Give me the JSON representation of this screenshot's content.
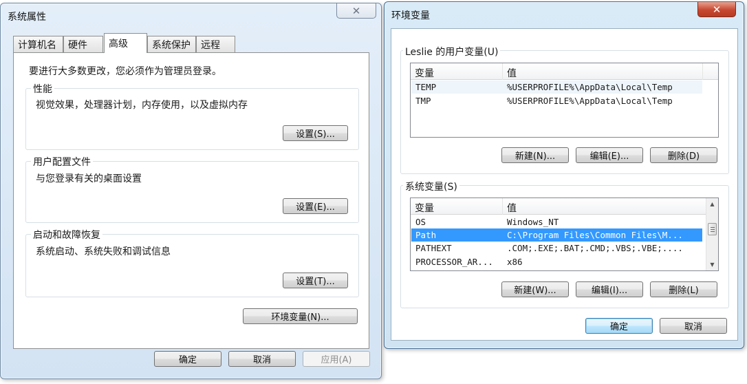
{
  "sys_window": {
    "title": "系统属性",
    "close_label": "✕",
    "tabs": [
      {
        "label": "计算机名"
      },
      {
        "label": "硬件"
      },
      {
        "label": "高级"
      },
      {
        "label": "系统保护"
      },
      {
        "label": "远程"
      }
    ],
    "admin_note": "要进行大多数更改，您必须作为管理员登录。",
    "groups": {
      "performance": {
        "legend": "性能",
        "desc": "视觉效果，处理器计划，内存使用，以及虚拟内存",
        "button": "设置(S)..."
      },
      "profiles": {
        "legend": "用户配置文件",
        "desc": "与您登录有关的桌面设置",
        "button": "设置(E)..."
      },
      "startup": {
        "legend": "启动和故障恢复",
        "desc": "系统启动、系统失败和调试信息",
        "button": "设置(T)..."
      }
    },
    "env_button": "环境变量(N)...",
    "ok": "确定",
    "cancel": "取消",
    "apply": "应用(A)"
  },
  "env_window": {
    "title": "环境变量",
    "close_label": "✕",
    "user_vars": {
      "legend": "Leslie 的用户变量(U)",
      "col_name": "变量",
      "col_value": "值",
      "rows": [
        {
          "name": "TEMP",
          "value": "%USERPROFILE%\\AppData\\Local\\Temp"
        },
        {
          "name": "TMP",
          "value": "%USERPROFILE%\\AppData\\Local\\Temp"
        }
      ],
      "new": "新建(N)...",
      "edit": "编辑(E)...",
      "delete": "删除(D)"
    },
    "sys_vars": {
      "legend": "系统变量(S)",
      "col_name": "变量",
      "col_value": "值",
      "rows": [
        {
          "name": "OS",
          "value": "Windows_NT"
        },
        {
          "name": "Path",
          "value": "C:\\Program Files\\Common Files\\M..."
        },
        {
          "name": "PATHEXT",
          "value": ".COM;.EXE;.BAT;.CMD;.VBS;.VBE;...."
        },
        {
          "name": "PROCESSOR_AR...",
          "value": "x86"
        }
      ],
      "new": "新建(W)...",
      "edit": "编辑(I)...",
      "delete": "删除(L)"
    },
    "ok": "确定",
    "cancel": "取消"
  },
  "icons": {
    "scroll_up": "▲",
    "scroll_down": "▼"
  }
}
